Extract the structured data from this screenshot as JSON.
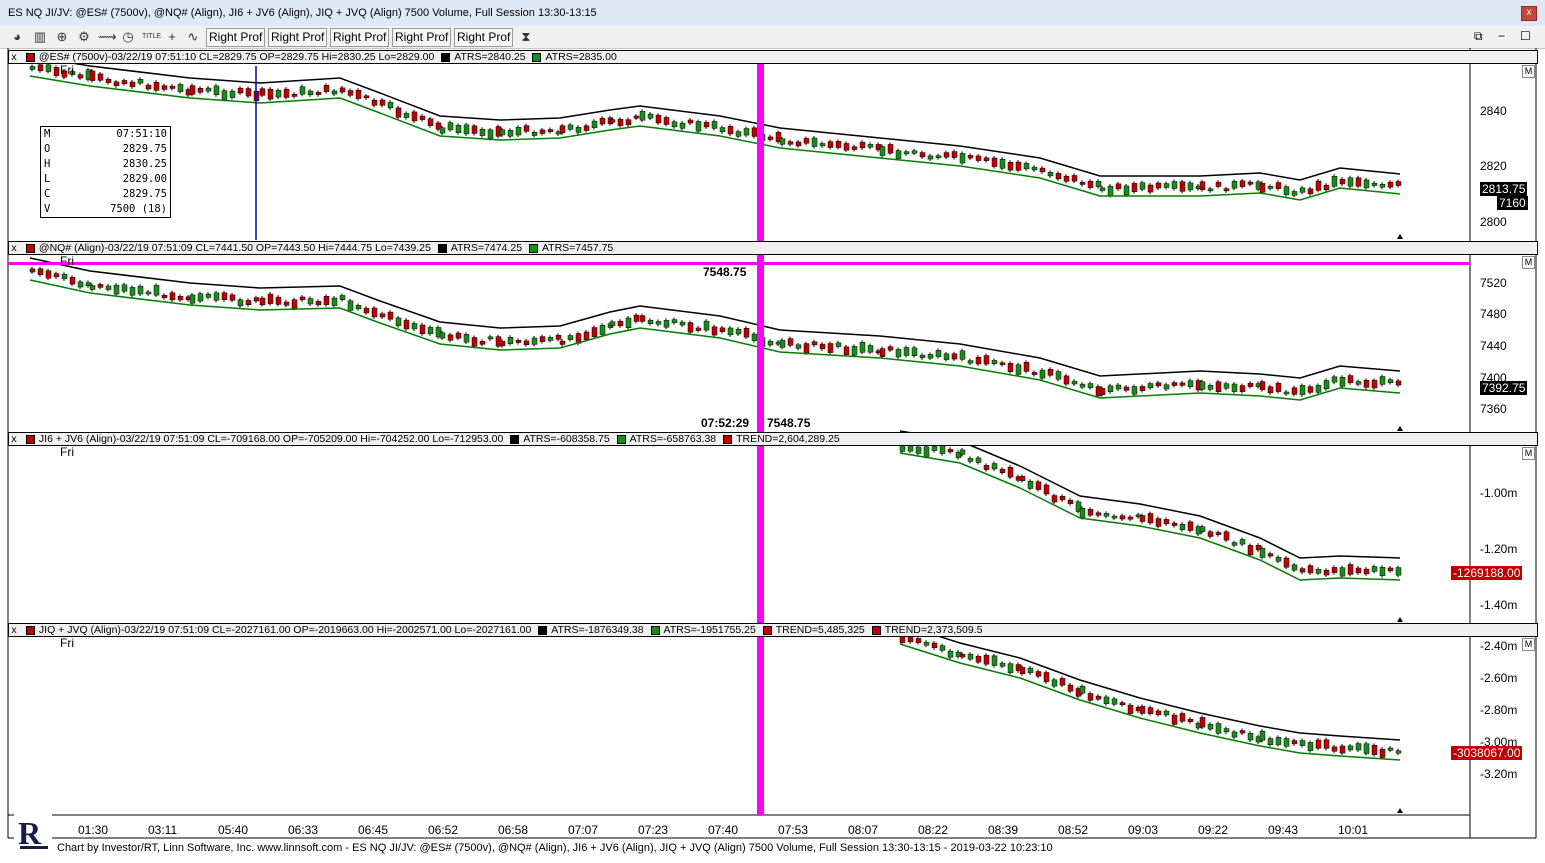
{
  "window": {
    "title": "ES NQ JI/JV: @ES# (7500v), @NQ# (Align), JI6 + JV6 (Align), JIQ + JVQ (Align) 7500 Volume, Full Session 13:30-13:15",
    "close": "x",
    "restore": "⧉",
    "minimize": "−",
    "maximize": "☐"
  },
  "toolbar": {
    "buttons": [
      "Right Prof",
      "Right Prof",
      "Right Prof",
      "Right Prof",
      "Right Prof"
    ],
    "title_icon_text": "TITLE",
    "icons": [
      "pie-icon",
      "bar-chart-icon",
      "zoom-icon",
      "gear-icon",
      "timeline-icon",
      "clock-icon",
      "title-icon",
      "crosshair-icon",
      "wave-icon",
      "hourglass-icon"
    ]
  },
  "panes": [
    {
      "header": {
        "close": "x",
        "symbol": "@ES# (7500v)-03/22/19 07:51:10 CL=2829.75 OP=2829.75 Hi=2830.25 Lo=2829.00",
        "atrs1": "ATRS=2840.25",
        "atrs2": "ATRS=2835.00",
        "extra": []
      },
      "day": "Fri",
      "yticks": [
        "2840",
        "2820",
        "2800"
      ],
      "last_price": "2813.75",
      "volume_tag": "7160",
      "m": "M"
    },
    {
      "header": {
        "close": "x",
        "symbol": "@NQ# (Align)-03/22/19 07:51:09 CL=7441.50 OP=7443.50 Hi=7444.75 Lo=7439.25",
        "atrs1": "ATRS=7474.25",
        "atrs2": "ATRS=7457.75",
        "extra": []
      },
      "day": "Fri",
      "yticks": [
        "7520",
        "7480",
        "7440",
        "7400",
        "7360"
      ],
      "last_price": "7392.75",
      "cursor_price": "7548.75",
      "cursor_time": "07:52:29",
      "cursor_price2": "7548.75",
      "m": "M"
    },
    {
      "header": {
        "close": "x",
        "symbol": "JI6 + JV6 (Align)-03/22/19 07:51:09 CL=-709168.00 OP=-705209.00 Hi=-704252.00 Lo=-712953.00",
        "atrs1": "ATRS=-608358.75",
        "atrs2": "ATRS=-658763.38",
        "extra": [
          "TREND=2,604,289.25"
        ]
      },
      "day": "Fri",
      "yticks": [
        "-1.00m",
        "-1.20m",
        "-1.40m"
      ],
      "last_price": "-1269188.00",
      "m": "M"
    },
    {
      "header": {
        "close": "x",
        "symbol": "JIQ + JVQ (Align)-03/22/19 07:51:09 CL=-2027161.00 OP=-2019663.00 Hi=-2002571.00 Lo=-2027161.00",
        "atrs1": "ATRS=-1876349.38",
        "atrs2": "ATRS=-1951755.25",
        "extra": [
          "TREND=5,485,325",
          "TREND=2,373,509.5"
        ]
      },
      "day": "Fri",
      "yticks": [
        "-2.40m",
        "-2.60m",
        "-2.80m",
        "-3.00m",
        "-3.20m"
      ],
      "last_price": "-3038067.00",
      "m": "M"
    }
  ],
  "ohlc": [
    {
      "k": "M",
      "v": "07:51:10"
    },
    {
      "k": "O",
      "v": "2829.75"
    },
    {
      "k": "H",
      "v": "2830.25"
    },
    {
      "k": "L",
      "v": "2829.00"
    },
    {
      "k": "C",
      "v": "2829.75"
    },
    {
      "k": "V",
      "v": "7500 (18)"
    }
  ],
  "xaxis": [
    "01:30",
    "03:11",
    "05:40",
    "06:33",
    "06:45",
    "06:52",
    "06:58",
    "07:07",
    "07:23",
    "07:40",
    "07:53",
    "08:07",
    "08:22",
    "08:39",
    "08:52",
    "09:03",
    "09:22",
    "09:43",
    "10:01"
  ],
  "footer": "Chart by Investor/RT, Linn Software, Inc. www.linnsoft.com - ES NQ JI/JV: @ES# (7500v), @NQ# (Align), JI6 + JV6 (Align), JIQ + JVQ (Align) 7500 Volume, Full Session 13:30-13:15 - 2019-03-22 10:23:10",
  "colors": {
    "cursor_line": "#ff00ff",
    "up_candle": "#1a8c1a",
    "down_candle": "#c00000",
    "atrs_black": "#000000",
    "atrs_green": "#008000",
    "blue_line": "#0000c0"
  }
}
